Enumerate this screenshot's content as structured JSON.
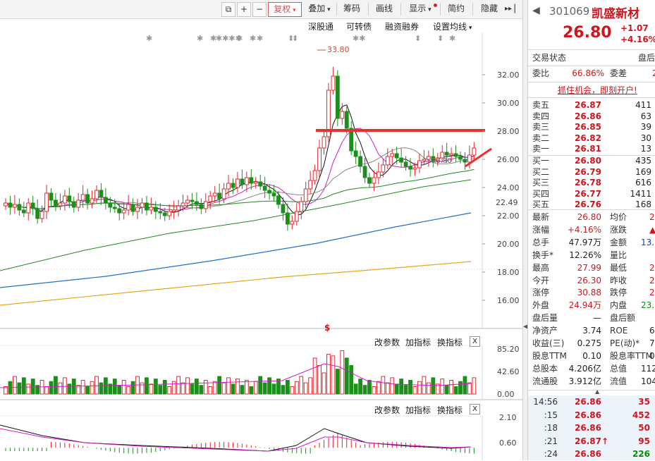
{
  "toolbar": {
    "fuquan": "复权",
    "diejia": "叠加",
    "chouma": "筹码",
    "huaxian": "画线",
    "xianshi": "显示",
    "jianyue": "简约",
    "yincang": "隐藏"
  },
  "chart_menu": {
    "shengutong": "深股通",
    "kezhuanzhai": "可转债",
    "rongzi": "融资融券",
    "junxian": "设置均线"
  },
  "price_chart": {
    "high_marker": "33.80",
    "current_price_tag": "22.49",
    "overlay_text": "26.80",
    "y_ticks": [
      "32.00",
      "30.00",
      "28.00",
      "26.00",
      "24.00",
      "22.00",
      "20.00",
      "18.00",
      "16.00"
    ]
  },
  "volume_panel": {
    "params_btn": "改参数",
    "add_btn": "加指标",
    "switch_btn": "换指标",
    "close_btn": "X",
    "y_ticks": [
      "85.20",
      "42.60",
      "0.00"
    ]
  },
  "macd_panel": {
    "params_btn": "改参数",
    "add_btn": "加指标",
    "switch_btn": "换指标",
    "close_btn": "X",
    "y_ticks": [
      "2.10",
      "0.60"
    ]
  },
  "stock": {
    "code": "301069",
    "name": "凯盛新材",
    "price": "26.80",
    "change": "+1.07",
    "change_pct": "+4.16%"
  },
  "status": {
    "trade_status": "交易状态",
    "after_hours": "盘后",
    "weibi_label": "委比",
    "weibi": "66.86%",
    "weicha_label": "委差",
    "weicha": "2"
  },
  "promo": "抓住机会，即刻开户!",
  "order_book": {
    "asks": [
      {
        "label": "卖五",
        "price": "26.87",
        "vol": "411"
      },
      {
        "label": "卖四",
        "price": "26.86",
        "vol": "63"
      },
      {
        "label": "卖三",
        "price": "26.85",
        "vol": "39"
      },
      {
        "label": "卖二",
        "price": "26.82",
        "vol": "30"
      },
      {
        "label": "卖一",
        "price": "26.81",
        "vol": "13"
      }
    ],
    "bids": [
      {
        "label": "买一",
        "price": "26.80",
        "vol": "435"
      },
      {
        "label": "买二",
        "price": "26.79",
        "vol": "169"
      },
      {
        "label": "买三",
        "price": "26.78",
        "vol": "616"
      },
      {
        "label": "买四",
        "price": "26.77",
        "vol": "1411"
      },
      {
        "label": "买五",
        "price": "26.76",
        "vol": "168"
      }
    ]
  },
  "quote": [
    {
      "l1": "最新",
      "v1": "26.80",
      "c1": "red",
      "l2": "均价",
      "v2": "2"
    },
    {
      "l1": "涨幅",
      "v1": "+4.16%",
      "c1": "red",
      "l2": "涨跌",
      "v2": "▲"
    },
    {
      "l1": "总手",
      "v1": "47.97万",
      "c1": "blk",
      "l2": "金额",
      "v2": "13."
    },
    {
      "l1": "换手*",
      "v1": "12.26%",
      "c1": "blk",
      "l2": "量比",
      "v2": ""
    },
    {
      "l1": "最高",
      "v1": "27.99",
      "c1": "red",
      "l2": "最低",
      "v2": "2"
    },
    {
      "l1": "今开",
      "v1": "26.30",
      "c1": "red",
      "l2": "昨收",
      "v2": "2"
    },
    {
      "l1": "涨停",
      "v1": "30.88",
      "c1": "red",
      "l2": "跌停",
      "v2": "2"
    },
    {
      "l1": "外盘",
      "v1": "24.94万",
      "c1": "red",
      "l2": "内盘",
      "v2": "23."
    },
    {
      "l1": "盘后量",
      "v1": "—",
      "c1": "blk",
      "l2": "盘后额",
      "v2": ""
    },
    {
      "l1": "净资产",
      "v1": "3.74",
      "c1": "blk",
      "l2": "ROE",
      "v2": "6"
    },
    {
      "l1": "收益(三)",
      "v1": "0.275",
      "c1": "blk",
      "l2": "PE(动)*",
      "v2": "7"
    },
    {
      "l1": "股息TTM",
      "v1": "0.10",
      "c1": "blk",
      "l2": "股息率TTM",
      "v2": "0"
    },
    {
      "l1": "总股本",
      "v1": "4.206亿",
      "c1": "blk",
      "l2": "总值",
      "v2": "112"
    },
    {
      "l1": "流通股",
      "v1": "3.912亿",
      "c1": "blk",
      "l2": "流值",
      "v2": "104"
    }
  ],
  "ticks": [
    {
      "time": "14:56",
      "price": "26.86",
      "vol": "35",
      "arrow": ""
    },
    {
      "time": ":15",
      "price": "26.86",
      "vol": "452",
      "arrow": ""
    },
    {
      "time": ":18",
      "price": "26.86",
      "vol": "50",
      "arrow": ""
    },
    {
      "time": ":21",
      "price": "26.87",
      "vol": "95",
      "arrow": "↑"
    },
    {
      "time": ":24",
      "price": "26.86",
      "vol": "226",
      "arrow": ""
    }
  ]
}
